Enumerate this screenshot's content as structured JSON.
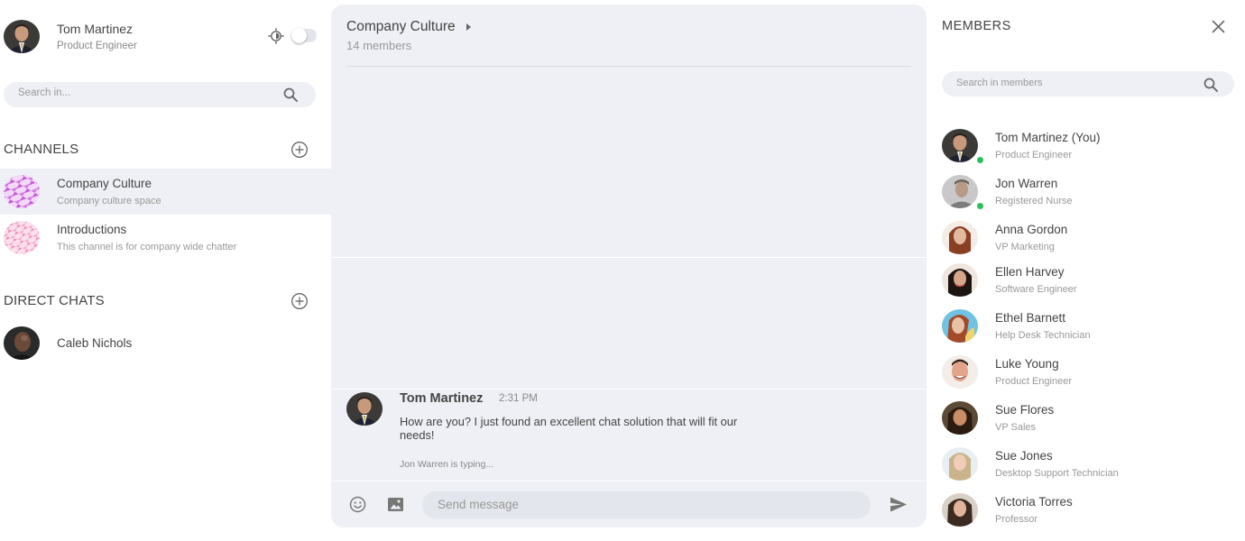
{
  "user": {
    "name": "Tom Martinez",
    "role": "Product Engineer"
  },
  "sidebar": {
    "search_placeholder": "Search in...",
    "channels_title": "CHANNELS",
    "direct_chats_title": "DIRECT CHATS",
    "channels": [
      {
        "name": "Company Culture",
        "description": "Company culture space",
        "active": true
      },
      {
        "name": "Introductions",
        "description": "This channel is for company wide chatter",
        "active": false
      }
    ],
    "direct_chats": [
      {
        "name": "Caleb Nichols"
      }
    ]
  },
  "chat": {
    "title": "Company Culture",
    "member_count": "14 members",
    "messages": [
      {
        "author": "Tom Martinez",
        "time": "2:31 PM",
        "text": "How are you? I just found an excellent chat solution that will fit our needs!"
      }
    ],
    "typing": "Jon Warren is typing...",
    "send_placeholder": "Send message"
  },
  "members_panel": {
    "title": "MEMBERS",
    "search_placeholder": "Search in members",
    "members": [
      {
        "name": "Tom Martinez (You)",
        "role": "Product Engineer",
        "online": true
      },
      {
        "name": "Jon Warren",
        "role": "Registered Nurse",
        "online": true
      },
      {
        "name": "Anna Gordon",
        "role": "VP Marketing",
        "online": false
      },
      {
        "name": "Ellen Harvey",
        "role": "Software Engineer",
        "online": false
      },
      {
        "name": "Ethel Barnett",
        "role": "Help Desk Technician",
        "online": false
      },
      {
        "name": "Luke Young",
        "role": "Product Engineer",
        "online": false
      },
      {
        "name": "Sue Flores",
        "role": "VP Sales",
        "online": false
      },
      {
        "name": "Sue Jones",
        "role": "Desktop Support Technician",
        "online": false
      },
      {
        "name": "Victoria Torres",
        "role": "Professor",
        "online": false
      }
    ]
  },
  "colors": {
    "panel_bg": "#eef0f5",
    "online": "#2ebd59",
    "text": "#444444",
    "muted": "#999999"
  }
}
